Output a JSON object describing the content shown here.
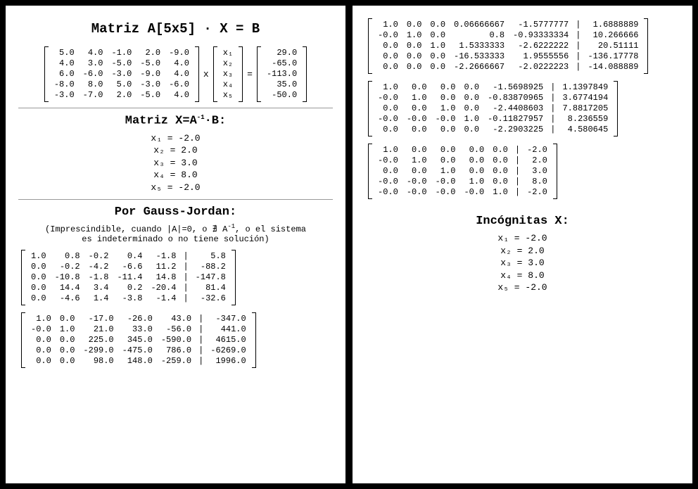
{
  "titles": {
    "main": "Matriz A[5x5] · X = B",
    "inv": "Matriz X=A⁻¹·B:",
    "gj": "Por Gauss-Jordan:",
    "incog": "Incógnitas X:"
  },
  "note": "(Imprescindible, cuando |A|=0, o ∄ A⁻¹, o el sistema es indeterminado o no tiene solución)",
  "ops": {
    "times": "x",
    "eq": "="
  },
  "xvec": [
    "x₁",
    "x₂",
    "x₃",
    "x₄",
    "x₅"
  ],
  "A": [
    [
      "5.0",
      "4.0",
      "-1.0",
      "2.0",
      "-9.0"
    ],
    [
      "4.0",
      "3.0",
      "-5.0",
      "-5.0",
      "4.0"
    ],
    [
      "6.0",
      "-6.0",
      "-3.0",
      "-9.0",
      "4.0"
    ],
    [
      "-8.0",
      "8.0",
      "5.0",
      "-3.0",
      "-6.0"
    ],
    [
      "-3.0",
      "-7.0",
      "2.0",
      "-5.0",
      "4.0"
    ]
  ],
  "B": [
    "29.0",
    "-65.0",
    "-113.0",
    "35.0",
    "-50.0"
  ],
  "solution": [
    "x₁ = -2.0",
    "x₂ = 2.0",
    "x₃ = 3.0",
    "x₄ = 8.0",
    "x₅ = -2.0"
  ],
  "steps": [
    [
      [
        "1.0",
        "0.8",
        "-0.2",
        "0.4",
        "-1.8",
        "|",
        "5.8"
      ],
      [
        "0.0",
        "-0.2",
        "-4.2",
        "-6.6",
        "11.2",
        "|",
        "-88.2"
      ],
      [
        "0.0",
        "-10.8",
        "-1.8",
        "-11.4",
        "14.8",
        "|",
        "-147.8"
      ],
      [
        "0.0",
        "14.4",
        "3.4",
        "0.2",
        "-20.4",
        "|",
        "81.4"
      ],
      [
        "0.0",
        "-4.6",
        "1.4",
        "-3.8",
        "-1.4",
        "|",
        "-32.6"
      ]
    ],
    [
      [
        "1.0",
        "0.0",
        "-17.0",
        "-26.0",
        "43.0",
        "|",
        "-347.0"
      ],
      [
        "-0.0",
        "1.0",
        "21.0",
        "33.0",
        "-56.0",
        "|",
        "441.0"
      ],
      [
        "0.0",
        "0.0",
        "225.0",
        "345.0",
        "-590.0",
        "|",
        "4615.0"
      ],
      [
        "0.0",
        "0.0",
        "-299.0",
        "-475.0",
        "786.0",
        "|",
        "-6269.0"
      ],
      [
        "0.0",
        "0.0",
        "98.0",
        "148.0",
        "-259.0",
        "|",
        "1996.0"
      ]
    ],
    [
      [
        "1.0",
        "0.0",
        "0.0",
        "0.06666667",
        "-1.5777777",
        "|",
        "1.6888889"
      ],
      [
        "-0.0",
        "1.0",
        "0.0",
        "0.8",
        "-0.93333334",
        "|",
        "10.266666"
      ],
      [
        "0.0",
        "0.0",
        "1.0",
        "1.5333333",
        "-2.6222222",
        "|",
        "20.51111"
      ],
      [
        "0.0",
        "0.0",
        "0.0",
        "-16.533333",
        "1.9555556",
        "|",
        "-136.17778"
      ],
      [
        "0.0",
        "0.0",
        "0.0",
        "-2.2666667",
        "-2.0222223",
        "|",
        "-14.088889"
      ]
    ],
    [
      [
        "1.0",
        "0.0",
        "0.0",
        "0.0",
        "-1.5698925",
        "|",
        "1.1397849"
      ],
      [
        "-0.0",
        "1.0",
        "0.0",
        "0.0",
        "-0.83870965",
        "|",
        "3.6774194"
      ],
      [
        "0.0",
        "0.0",
        "1.0",
        "0.0",
        "-2.4408603",
        "|",
        "7.8817205"
      ],
      [
        "-0.0",
        "-0.0",
        "-0.0",
        "1.0",
        "-0.11827957",
        "|",
        "8.236559"
      ],
      [
        "0.0",
        "0.0",
        "0.0",
        "0.0",
        "-2.2903225",
        "|",
        "4.580645"
      ]
    ],
    [
      [
        "1.0",
        "0.0",
        "0.0",
        "0.0",
        "0.0",
        "|",
        "-2.0"
      ],
      [
        "-0.0",
        "1.0",
        "0.0",
        "0.0",
        "0.0",
        "|",
        "2.0"
      ],
      [
        "0.0",
        "0.0",
        "1.0",
        "0.0",
        "0.0",
        "|",
        "3.0"
      ],
      [
        "-0.0",
        "-0.0",
        "-0.0",
        "1.0",
        "0.0",
        "|",
        "8.0"
      ],
      [
        "-0.0",
        "-0.0",
        "-0.0",
        "-0.0",
        "1.0",
        "|",
        "-2.0"
      ]
    ]
  ]
}
